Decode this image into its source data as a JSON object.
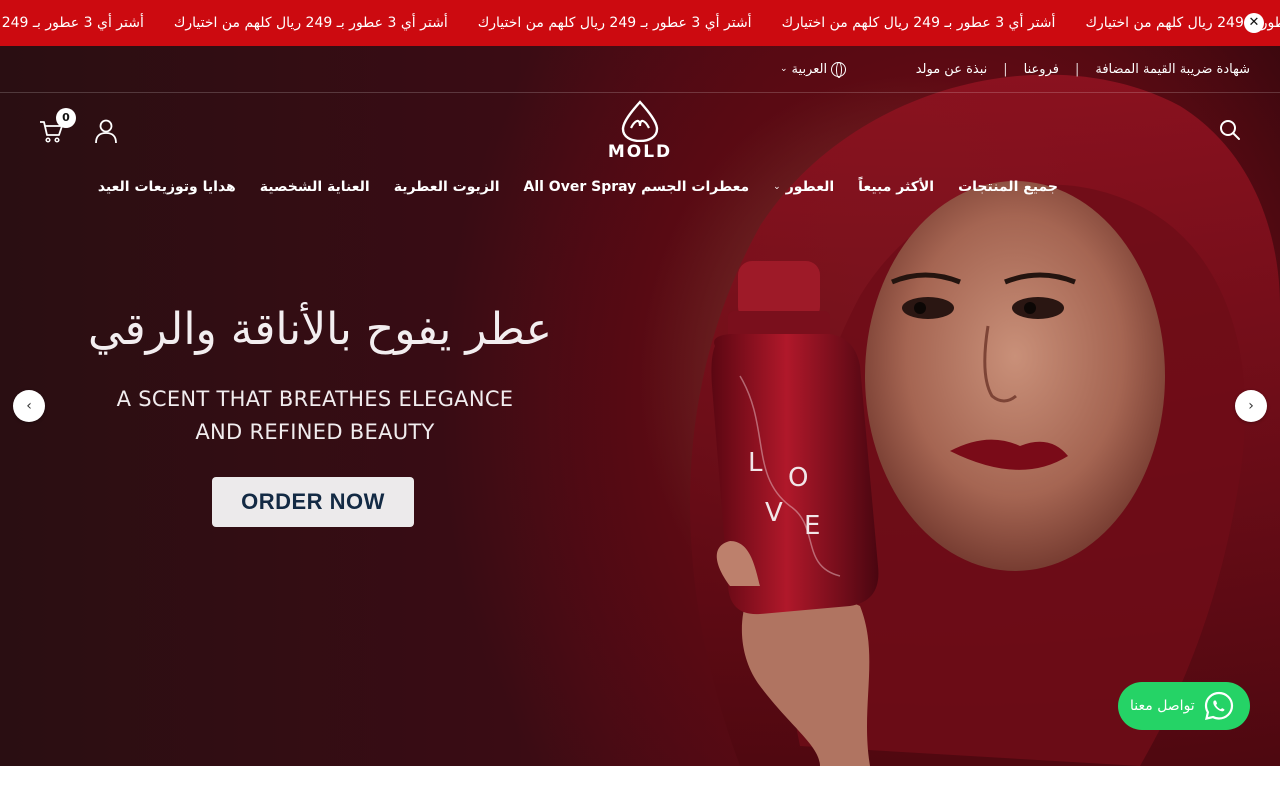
{
  "announcement": {
    "items": [
      "أشتر أي 3 عطور بـ 249 ريال كلهم من اختيارك",
      "أشتر أي 3 عطور بـ 249 ريال كلهم من اختيارك",
      "أشتر أي 3 عطور بـ 249 ريال كلهم من اختيارك",
      "أشتر أي 3 عطور بـ 249 ريال كلهم من اختيارك",
      "أشتر أي 3 عطور بـ 249 ريال كلهم من اختيارك"
    ],
    "close_symbol": "✕",
    "background": "#cc0a10"
  },
  "utility": {
    "links": [
      "نبذة عن مولد",
      "فروعنا",
      "شهادة ضريبة القيمة المضافة"
    ],
    "separator": "|",
    "language": "العربية"
  },
  "header": {
    "logo_text": "MOLD",
    "cart_count": "0",
    "icons": [
      "search-icon",
      "user-icon",
      "cart-icon"
    ]
  },
  "nav": {
    "items": [
      {
        "label": "جميع المنتجات"
      },
      {
        "label": "الأكثر مبيعاً"
      },
      {
        "label": "العطور",
        "has_dropdown": true
      },
      {
        "label": "معطرات الجسم All Over Spray"
      },
      {
        "label": "الزيوت العطرية"
      },
      {
        "label": "العناية الشخصية"
      },
      {
        "label": "هدايا وتوزيعات العيد"
      }
    ]
  },
  "hero": {
    "title_ar": "عطر يفوح بالأناقة والرقي",
    "subtitle_line1": "A SCENT THAT BREATHES ELEGANCE",
    "subtitle_line2": "AND REFINED BEAUTY",
    "cta": "ORDER NOW",
    "bottle_text": [
      "L",
      "O",
      "V",
      "E"
    ]
  },
  "slider": {
    "prev_symbol": "‹",
    "next_symbol": "›"
  },
  "whatsapp": {
    "label": "تواصل معنا",
    "color": "#25d366"
  }
}
